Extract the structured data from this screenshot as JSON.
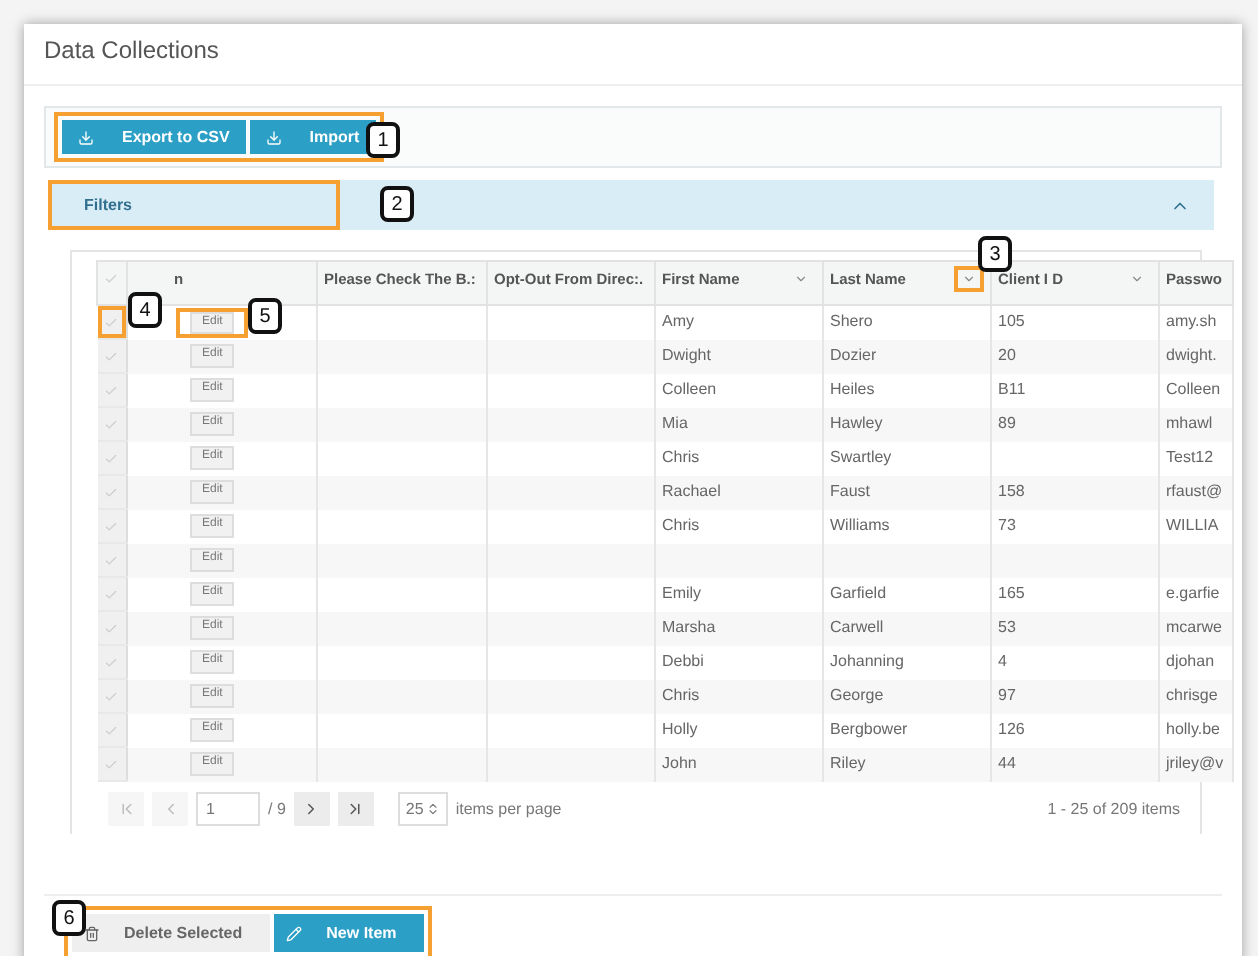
{
  "page_title": "Data Collections",
  "toolbar": {
    "highlighted": true,
    "buttons": [
      {
        "label": "Export to CSV"
      },
      {
        "label": "Import"
      }
    ]
  },
  "filters": {
    "label": "Filters",
    "expanded": true,
    "highlighted": true
  },
  "table": {
    "columns": [
      {
        "kind": "check"
      },
      {
        "kind": "action",
        "label": "n"
      },
      {
        "kind": "text",
        "label": "Please Check The B.:",
        "sortable": false
      },
      {
        "kind": "text",
        "label": "Opt-Out From Direc:.",
        "sortable": false
      },
      {
        "kind": "text",
        "label": "First Name",
        "sortable": true,
        "highlighted": false
      },
      {
        "kind": "text",
        "label": "Last Name",
        "sortable": true,
        "highlighted": true
      },
      {
        "kind": "text",
        "label": "Client I D",
        "sortable": true,
        "highlighted": false
      },
      {
        "kind": "text",
        "label": "Passwo",
        "sortable": false
      }
    ],
    "rows": [
      {
        "checked": false,
        "check_highlighted": true,
        "edit": "Edit",
        "edit_highlighted": true,
        "first_name": "Amy",
        "last_name": "Shero",
        "client_id": "105",
        "password": "amy.sh"
      },
      {
        "checked": false,
        "check_highlighted": false,
        "edit": "Edit",
        "edit_highlighted": false,
        "first_name": "Dwight",
        "last_name": "Dozier",
        "client_id": "20",
        "password": "dwight."
      },
      {
        "checked": false,
        "check_highlighted": false,
        "edit": "Edit",
        "edit_highlighted": false,
        "first_name": "Colleen",
        "last_name": "Heiles",
        "client_id": "B11",
        "password": "Colleen"
      },
      {
        "checked": false,
        "check_highlighted": false,
        "edit": "Edit",
        "edit_highlighted": false,
        "first_name": "Mia",
        "last_name": "Hawley",
        "client_id": "89",
        "password": "mhawl"
      },
      {
        "checked": false,
        "check_highlighted": false,
        "edit": "Edit",
        "edit_highlighted": false,
        "first_name": "Chris",
        "last_name": "Swartley",
        "password": "Test12"
      },
      {
        "checked": false,
        "check_highlighted": false,
        "edit": "Edit",
        "edit_highlighted": false,
        "first_name": "Rachael",
        "last_name": "Faust",
        "client_id": "158",
        "password": "rfaust@"
      },
      {
        "checked": false,
        "check_highlighted": false,
        "edit": "Edit",
        "edit_highlighted": false,
        "first_name": "Chris",
        "last_name": "Williams",
        "client_id": "73",
        "password": "WILLIA"
      },
      {
        "checked": false,
        "check_highlighted": false,
        "edit": "Edit",
        "edit_highlighted": false
      },
      {
        "checked": false,
        "check_highlighted": false,
        "edit": "Edit",
        "edit_highlighted": false,
        "first_name": "Emily",
        "last_name": "Garfield",
        "client_id": "165",
        "password": "e.garfie"
      },
      {
        "checked": false,
        "check_highlighted": false,
        "edit": "Edit",
        "edit_highlighted": false,
        "first_name": "Marsha",
        "last_name": "Carwell",
        "client_id": "53",
        "password": "mcarwe"
      },
      {
        "checked": false,
        "check_highlighted": false,
        "edit": "Edit",
        "edit_highlighted": false,
        "first_name": "Debbi",
        "last_name": "Johanning",
        "client_id": "4",
        "password": "djohan"
      },
      {
        "checked": false,
        "check_highlighted": false,
        "edit": "Edit",
        "edit_highlighted": false,
        "first_name": "Chris",
        "last_name": "George",
        "client_id": "97",
        "password": "chrisge"
      },
      {
        "checked": false,
        "check_highlighted": false,
        "edit": "Edit",
        "edit_highlighted": false,
        "first_name": "Holly",
        "last_name": "Bergbower",
        "client_id": "126",
        "password": "holly.be"
      },
      {
        "checked": false,
        "check_highlighted": false,
        "edit": "Edit",
        "edit_highlighted": false,
        "first_name": "John",
        "last_name": "Riley",
        "client_id": "44",
        "password": "jriley@v"
      }
    ]
  },
  "pager": {
    "page": "1",
    "total": "/ 9",
    "page_size": "25",
    "size_label": "items per page",
    "summary": "1 - 25 of 209 items"
  },
  "footer": {
    "highlighted": true,
    "buttons": [
      {
        "label": "Delete Selected",
        "kind": "secondary"
      },
      {
        "label": "New Item",
        "kind": "primary"
      }
    ]
  },
  "callouts": [
    {
      "number": "1"
    },
    {
      "number": "2"
    },
    {
      "number": "3"
    },
    {
      "number": "4"
    },
    {
      "number": "5"
    },
    {
      "number": "6"
    }
  ]
}
